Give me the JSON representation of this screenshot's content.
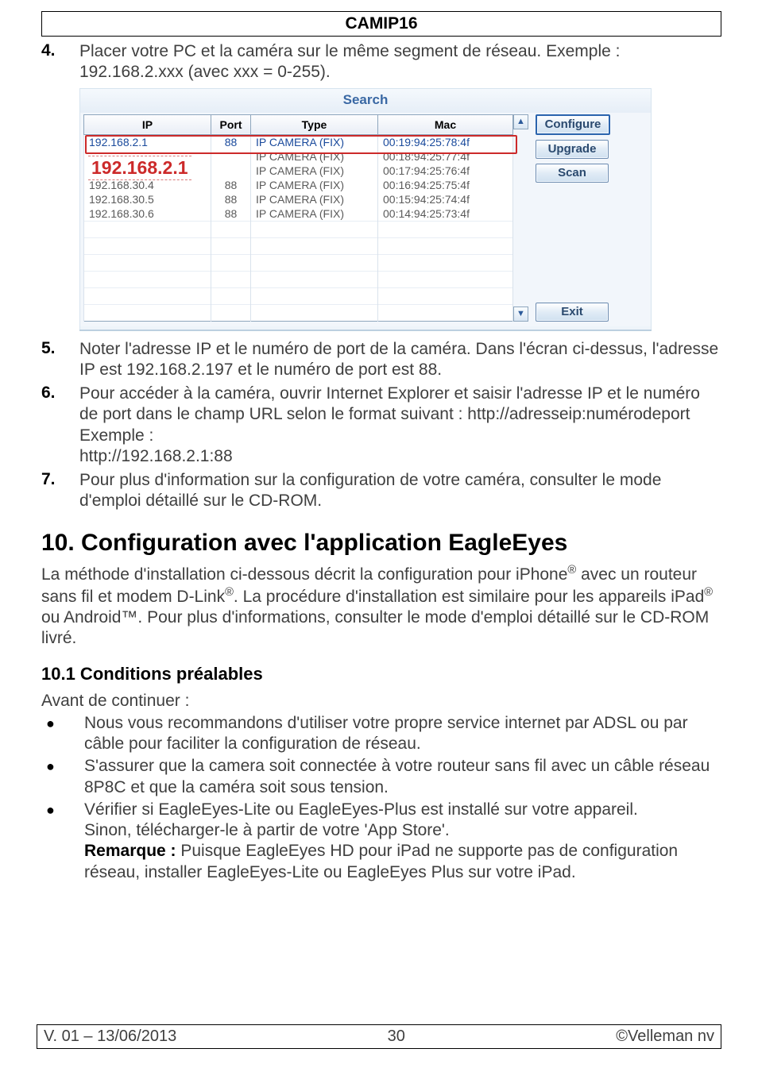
{
  "header": {
    "title": "CAMIP16"
  },
  "list": {
    "n4": "4.",
    "t4": "Placer votre PC et la caméra sur le même segment de réseau. Exemple : 192.168.2.xxx (avec xxx = 0-255).",
    "n5": "5.",
    "t5": "Noter l'adresse IP et le numéro de port de la caméra. Dans l'écran ci-dessus, l'adresse IP est 192.168.2.197 et le numéro de port est 88.",
    "n6": "6.",
    "t6a": "Pour accéder à la caméra, ouvrir Internet Explorer et saisir l'adresse IP et le numéro de port dans le champ URL selon le format suivant : http://adresseip:numérodeport",
    "t6b": "Exemple :",
    "t6c": "http://192.168.2.1:88",
    "n7": "7.",
    "t7": "Pour plus d'information sur la configuration de votre caméra, consulter le mode d'emploi détaillé sur le CD-ROM."
  },
  "search": {
    "title": "Search",
    "headers": {
      "ip": "IP",
      "port": "Port",
      "type": "Type",
      "mac": "Mac"
    },
    "rows": [
      {
        "ip": "192.168.2.1",
        "port": "88",
        "type": "IP CAMERA (FIX)",
        "mac": "00:19:94:25:78:4f",
        "sel": true
      },
      {
        "ip": "",
        "port": "",
        "type": "IP CAMERA (FIX)",
        "mac": "00:18:94:25:77:4f"
      },
      {
        "ip": "",
        "port": "",
        "type": "IP CAMERA (FIX)",
        "mac": "00:17:94:25:76:4f"
      },
      {
        "ip": "192.168.30.4",
        "port": "88",
        "type": "IP CAMERA (FIX)",
        "mac": "00:16:94:25:75:4f"
      },
      {
        "ip": "192.168.30.5",
        "port": "88",
        "type": "IP CAMERA (FIX)",
        "mac": "00:15:94:25:74:4f"
      },
      {
        "ip": "192.168.30.6",
        "port": "88",
        "type": "IP CAMERA (FIX)",
        "mac": "00:14:94:25:73:4f"
      }
    ],
    "zoom_label": "192.168.2.1",
    "buttons": {
      "configure": "Configure",
      "upgrade": "Upgrade",
      "scan": "Scan",
      "exit": "Exit"
    },
    "scroll": {
      "up": "▲",
      "down": "▼"
    }
  },
  "section10": {
    "heading": "10.  Configuration avec l'application EagleEyes",
    "p1a": "La méthode d'installation ci-dessous décrit la configuration pour iPhone",
    "p1b": " avec un routeur sans fil et modem D-Link",
    "p1c": ". La procédure d'installation est similaire pour les appareils iPad",
    "p1d": " ou Android™. Pour plus d'informations, consulter le mode d'emploi détaillé sur le CD-ROM livré.",
    "reg": "®"
  },
  "sub101": {
    "heading": "10.1  Conditions préalables",
    "intro": "Avant de continuer :",
    "b1": "Nous vous recommandons d'utiliser votre propre service internet par ADSL ou par câble pour faciliter la configuration de réseau.",
    "b2": "S'assurer que la camera soit connectée à votre routeur sans fil avec un câble réseau 8P8C et que la caméra soit sous tension.",
    "b3a": "Vérifier si EagleEyes-Lite ou EagleEyes-Plus est installé sur votre appareil.",
    "b3b": "Sinon, télécharger-le à partir de votre 'App Store'.",
    "b3c_label": "Remarque :",
    "b3c": " Puisque EagleEyes HD pour iPad ne supporte pas de configuration réseau, installer EagleEyes-Lite ou EagleEyes Plus sur votre iPad."
  },
  "footer": {
    "left": "V. 01 – 13/06/2013",
    "center": "30",
    "right": "©Velleman nv"
  }
}
